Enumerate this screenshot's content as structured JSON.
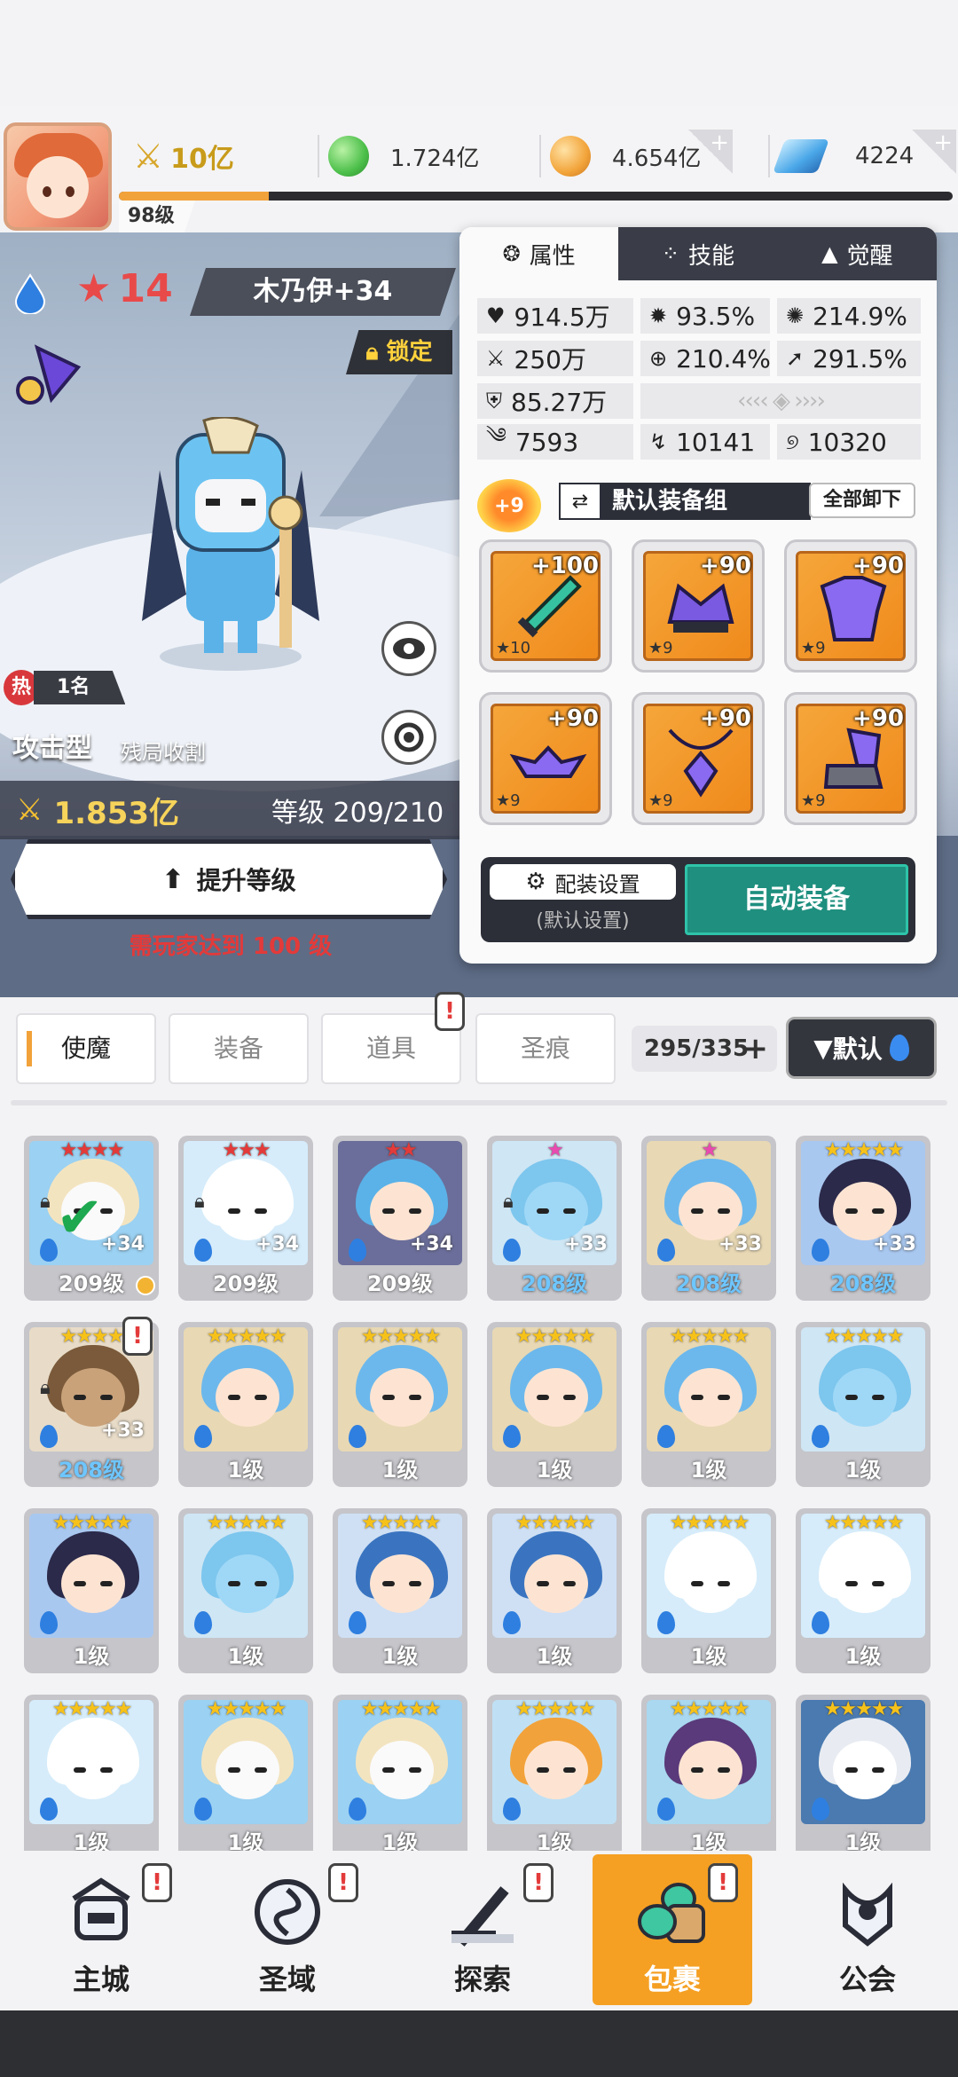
{
  "top_bar": {
    "power": "10亿",
    "green_currency": "1.724亿",
    "gold_currency": "4.654亿",
    "gems": "4224",
    "player_level": "98级",
    "xp_progress": 0.18
  },
  "hero": {
    "stars": "14",
    "name": "木乃伊+34",
    "lock_label": "锁定",
    "hot_rank": "1名",
    "hot_label": "热",
    "type": "攻击型",
    "role": "残局收割",
    "power": "1.853亿",
    "level_text": "等级 209/210",
    "upgrade_label": "提升等级",
    "requirement": "需玩家达到 100 级"
  },
  "panel": {
    "tabs": [
      {
        "label": "属性",
        "icon": "attribute-icon"
      },
      {
        "label": "技能",
        "icon": "skill-icon"
      },
      {
        "label": "觉醒",
        "icon": "awaken-icon"
      }
    ],
    "stats": {
      "hp": "914.5万",
      "crit_rate": "93.5%",
      "crit_dmg": "214.9%",
      "atk": "250万",
      "accuracy": "210.4%",
      "speed": "291.5%",
      "def": "85.27万",
      "stat_a": "7593",
      "stat_b": "10141",
      "stat_c": "10320"
    },
    "set_bonus": "+9",
    "gear_set_label": "默认装备组",
    "unequip_all": "全部卸下",
    "equipment": [
      {
        "slot": "weapon",
        "plus": "+100",
        "stars": "★10"
      },
      {
        "slot": "helmet",
        "plus": "+90",
        "stars": "★9"
      },
      {
        "slot": "armor",
        "plus": "+90",
        "stars": "★9"
      },
      {
        "slot": "belt",
        "plus": "+90",
        "stars": "★9"
      },
      {
        "slot": "necklace",
        "plus": "+90",
        "stars": "★9"
      },
      {
        "slot": "boots",
        "plus": "+90",
        "stars": "★9"
      }
    ],
    "loadout_label": "配装设置",
    "loadout_sub": "(默认设置)",
    "auto_equip": "自动装备"
  },
  "inventory": {
    "tabs": [
      "使魔",
      "装备",
      "道具",
      "圣痕"
    ],
    "count": "295/335",
    "sort_label": "默认",
    "cards": [
      {
        "stars": "★★★★",
        "level": "209级",
        "plus": "+34",
        "locked": true,
        "check": true,
        "coin": true,
        "blue": false,
        "char": "knight",
        "star_color": "#e33a3a"
      },
      {
        "stars": "★★★",
        "level": "209级",
        "plus": "+34",
        "locked": true,
        "check": false,
        "coin": false,
        "blue": false,
        "char": "bunny",
        "star_color": "#e33a3a"
      },
      {
        "stars": "★★",
        "level": "209级",
        "plus": "+34",
        "locked": false,
        "check": false,
        "coin": false,
        "blue": false,
        "char": "bat",
        "star_color": "#e33a3a"
      },
      {
        "stars": "★",
        "level": "208级",
        "plus": "+33",
        "locked": true,
        "check": false,
        "coin": false,
        "blue": true,
        "char": "dragon",
        "star_color": "#e84ab0"
      },
      {
        "stars": "★",
        "level": "208级",
        "plus": "+33",
        "locked": false,
        "check": false,
        "coin": false,
        "blue": true,
        "char": "angel",
        "star_color": "#e84ab0"
      },
      {
        "stars": "★★★★★",
        "level": "208级",
        "plus": "+33",
        "locked": false,
        "check": false,
        "coin": false,
        "blue": true,
        "char": "girl",
        "star_color": "#f6c21a"
      },
      {
        "stars": "★★★★",
        "level": "208级",
        "plus": "+33",
        "locked": true,
        "check": false,
        "coin": false,
        "blue": true,
        "char": "mask",
        "star_color": "#f6c21a"
      },
      {
        "stars": "★★★★★",
        "level": "1级",
        "plus": "",
        "locked": false,
        "check": false,
        "coin": false,
        "blue": false,
        "char": "angel",
        "star_color": "#f6c21a"
      },
      {
        "stars": "★★★★★",
        "level": "1级",
        "plus": "",
        "locked": false,
        "check": false,
        "coin": false,
        "blue": false,
        "char": "angel",
        "star_color": "#f6c21a"
      },
      {
        "stars": "★★★★★",
        "level": "1级",
        "plus": "",
        "locked": false,
        "check": false,
        "coin": false,
        "blue": false,
        "char": "angel",
        "star_color": "#f6c21a"
      },
      {
        "stars": "★★★★★",
        "level": "1级",
        "plus": "",
        "locked": false,
        "check": false,
        "coin": false,
        "blue": false,
        "char": "angel",
        "star_color": "#f6c21a"
      },
      {
        "stars": "★★★★★",
        "level": "1级",
        "plus": "",
        "locked": false,
        "check": false,
        "coin": false,
        "blue": false,
        "char": "dragon",
        "star_color": "#f6c21a"
      },
      {
        "stars": "★★★★★",
        "level": "1级",
        "plus": "",
        "locked": false,
        "check": false,
        "coin": false,
        "blue": false,
        "char": "girl",
        "star_color": "#f6c21a"
      },
      {
        "stars": "★★★★★",
        "level": "1级",
        "plus": "",
        "locked": false,
        "check": false,
        "coin": false,
        "blue": false,
        "char": "dragon",
        "star_color": "#f6c21a"
      },
      {
        "stars": "★★★★★",
        "level": "1级",
        "plus": "",
        "locked": false,
        "check": false,
        "coin": false,
        "blue": false,
        "char": "witch",
        "star_color": "#f6c21a"
      },
      {
        "stars": "★★★★★",
        "level": "1级",
        "plus": "",
        "locked": false,
        "check": false,
        "coin": false,
        "blue": false,
        "char": "witch",
        "star_color": "#f6c21a"
      },
      {
        "stars": "★★★★★",
        "level": "1级",
        "plus": "",
        "locked": false,
        "check": false,
        "coin": false,
        "blue": false,
        "char": "bunny",
        "star_color": "#f6c21a"
      },
      {
        "stars": "★★★★★",
        "level": "1级",
        "plus": "",
        "locked": false,
        "check": false,
        "coin": false,
        "blue": false,
        "char": "bunny",
        "star_color": "#f6c21a"
      },
      {
        "stars": "★★★★★",
        "level": "1级",
        "plus": "",
        "locked": false,
        "check": false,
        "coin": false,
        "blue": false,
        "char": "bunny",
        "star_color": "#f6c21a"
      },
      {
        "stars": "★★★★★",
        "level": "1级",
        "plus": "",
        "locked": false,
        "check": false,
        "coin": false,
        "blue": false,
        "char": "knight",
        "star_color": "#f6c21a"
      },
      {
        "stars": "★★★★★",
        "level": "1级",
        "plus": "",
        "locked": false,
        "check": false,
        "coin": false,
        "blue": false,
        "char": "knight",
        "star_color": "#f6c21a"
      },
      {
        "stars": "★★★★★",
        "level": "1级",
        "plus": "",
        "locked": false,
        "check": false,
        "coin": false,
        "blue": false,
        "char": "queen",
        "star_color": "#f6c21a"
      },
      {
        "stars": "★★★★★",
        "level": "1级",
        "plus": "",
        "locked": false,
        "check": false,
        "coin": false,
        "blue": false,
        "char": "wizard",
        "star_color": "#f6c21a"
      },
      {
        "stars": "★★★★★",
        "level": "1级",
        "plus": "",
        "locked": false,
        "check": false,
        "coin": false,
        "blue": false,
        "char": "mummy",
        "star_color": "#f6c21a"
      }
    ]
  },
  "bottom_nav": [
    {
      "label": "主城",
      "icon": "castle-icon",
      "badge": true,
      "active": false
    },
    {
      "label": "圣域",
      "icon": "vortex-icon",
      "badge": true,
      "active": false
    },
    {
      "label": "探索",
      "icon": "sword-icon",
      "badge": true,
      "active": false
    },
    {
      "label": "包裹",
      "icon": "bag-icon",
      "badge": true,
      "active": true
    },
    {
      "label": "公会",
      "icon": "guild-icon",
      "badge": false,
      "active": false
    }
  ],
  "colors": {
    "accent_orange": "#f2a23a",
    "auto_equip_teal": "#1f8f7f",
    "dark_panel": "#2c2f38",
    "warning_red": "#e33a3a"
  }
}
